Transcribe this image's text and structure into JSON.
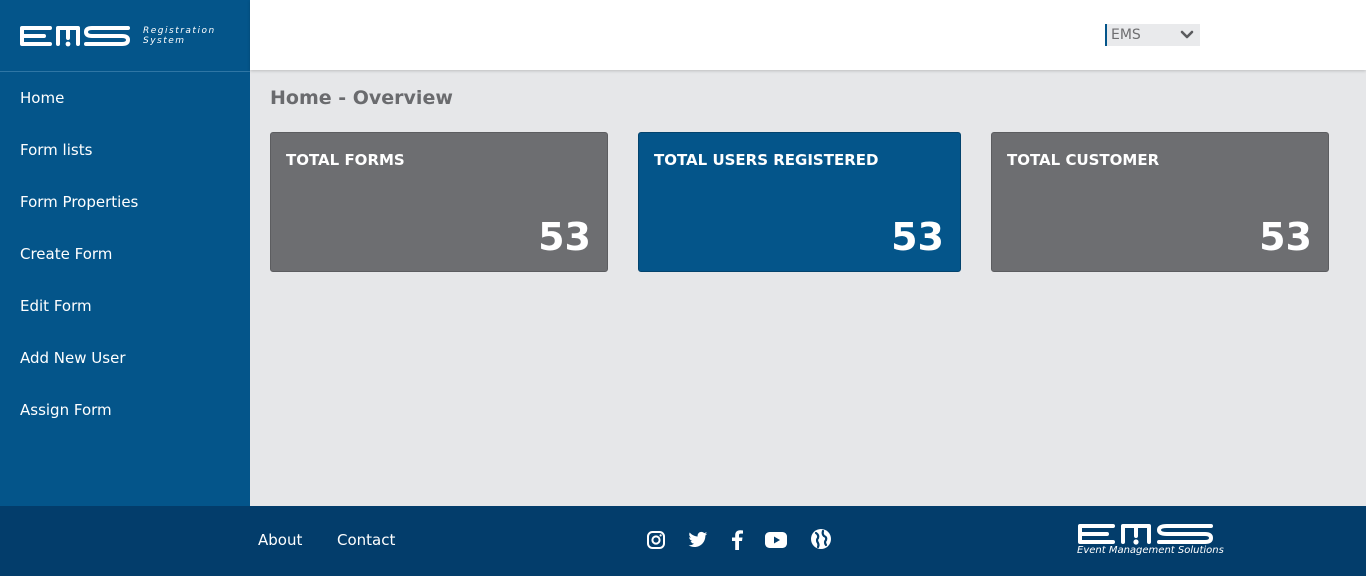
{
  "brand": {
    "logo_text": "EMS",
    "subtitle_line1": "Registration",
    "subtitle_line2": "System",
    "accent_color": "#04558a",
    "gray_color": "#6d6e71",
    "footer_color": "#033d6b"
  },
  "sidebar": {
    "items": [
      {
        "label": "Home"
      },
      {
        "label": "Form lists"
      },
      {
        "label": "Form Properties"
      },
      {
        "label": "Create Form"
      },
      {
        "label": "Edit Form"
      },
      {
        "label": "Add New User"
      },
      {
        "label": "Assign Form"
      }
    ]
  },
  "header": {
    "org_select": {
      "value": "EMS",
      "icon": "chevron-down-icon"
    }
  },
  "main": {
    "page_title": "Home - Overview",
    "cards": [
      {
        "label": "TOTAL FORMS",
        "value": "53"
      },
      {
        "label": "TOTAL USERS REGISTERED",
        "value": "53"
      },
      {
        "label": "TOTAL CUSTOMER",
        "value": "53"
      }
    ]
  },
  "footer": {
    "links": [
      {
        "label": "About"
      },
      {
        "label": "Contact"
      }
    ],
    "social_icons": [
      "instagram-icon",
      "twitter-icon",
      "facebook-icon",
      "youtube-icon",
      "globe-icon"
    ],
    "logo_text": "EMS",
    "tagline": "Event Management Solutions"
  }
}
